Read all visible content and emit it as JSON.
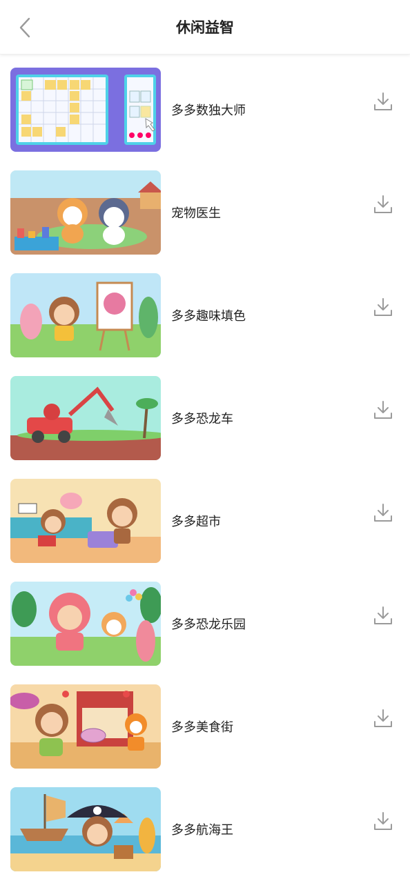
{
  "header": {
    "title": "休闲益智",
    "back_icon": "chevron-left-icon"
  },
  "games": [
    {
      "name": "多多数独大师",
      "theme": "sudoku"
    },
    {
      "name": "宠物医生",
      "theme": "pets"
    },
    {
      "name": "多多趣味填色",
      "theme": "coloring"
    },
    {
      "name": "多多恐龙车",
      "theme": "dinocar"
    },
    {
      "name": "多多超市",
      "theme": "supermarket"
    },
    {
      "name": "多多恐龙乐园",
      "theme": "dinopark"
    },
    {
      "name": "多多美食街",
      "theme": "foodstreet"
    },
    {
      "name": "多多航海王",
      "theme": "pirate"
    }
  ],
  "icons": {
    "download": "download-icon"
  },
  "colors": {
    "text": "#222222",
    "icon": "#9a9a9a",
    "background": "#ffffff"
  }
}
